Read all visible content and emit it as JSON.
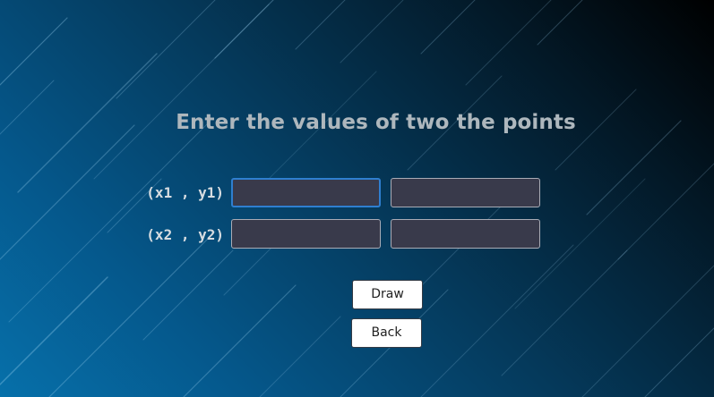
{
  "page": {
    "title": "Enter the values of two the points"
  },
  "form": {
    "rows": [
      {
        "label": "(x1 , y1)",
        "x_input": {
          "value": "",
          "placeholder": ""
        },
        "y_input": {
          "value": "",
          "placeholder": ""
        }
      },
      {
        "label": "(x2 , y2)",
        "x_input": {
          "value": "",
          "placeholder": ""
        },
        "y_input": {
          "value": "",
          "placeholder": ""
        }
      }
    ],
    "focused_field": "x1"
  },
  "buttons": {
    "draw_label": "Draw",
    "back_label": "Back"
  },
  "colors": {
    "background_dark": "#000000",
    "background_blue": "#0670aa",
    "title": "#aeb7bd",
    "label": "#d8dde1",
    "input_fill": "#393a4b",
    "input_border": "#a9acb6",
    "focus_border": "#2f7fd0",
    "button_fill": "#ffffff"
  }
}
